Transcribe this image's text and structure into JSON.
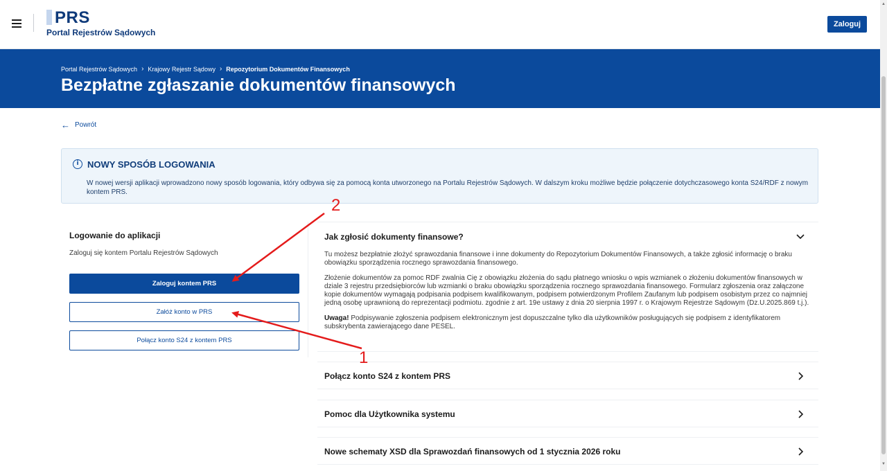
{
  "header": {
    "logo_title": "PRS",
    "logo_subtitle": "Portal Rejestrów Sądowych",
    "login_button": "Zaloguj"
  },
  "banner": {
    "breadcrumb": [
      "Portal Rejestrów Sądowych",
      "Krajowy Rejestr Sądowy",
      "Repozytorium Dokumentów Finansowych"
    ],
    "title": "Bezpłatne zgłaszanie dokumentów finansowych"
  },
  "back_link": "Powrót",
  "info": {
    "icon_glyph": "i",
    "title": "NOWY SPOSÓB LOGOWANIA",
    "text": "W nowej wersji aplikacji wprowadzono nowy sposób logowania, który odbywa się za pomocą konta utworzonego na Portalu Rejestrów Sądowych. W dalszym kroku możliwe będzie połączenie dotychczasowego konta S24/RDF z nowym kontem PRS."
  },
  "login_panel": {
    "title": "Logowanie do aplikacji",
    "description": "Zaloguj się kontem Portalu Rejestrów Sądowych",
    "login_button": "Zaloguj kontem PRS",
    "register_button": "Załóż konto w PRS",
    "connect_button": "Połącz konto S24 z kontem PRS"
  },
  "accordion": {
    "open_item": {
      "title": "Jak zgłosić dokumenty finansowe?",
      "p1": "Tu możesz bezpłatnie złożyć sprawozdania finansowe i inne dokumenty do Repozytorium Dokumentów Finansowych, a także zgłosić informację o braku obowiązku sporządzenia rocznego sprawozdania finansowego.",
      "p2": "Złożenie dokumentów za pomoc RDF zwalnia Cię z obowiązku złożenia do sądu płatnego wniosku o wpis wzmianek o złożeniu dokumentów finansowych w dziale 3 rejestru przedsiębiorców lub wzmianki o braku obowiązku sporządzenia rocznego sprawozdania finansowego. Formularz zgłoszenia oraz załączone kopie dokumentów wymagają podpisania podpisem kwalifikowanym, podpisem potwierdzonym Profilem Zaufanym lub podpisem osobistym przez co najmniej jedną osobę uprawnioną do reprezentacji podmiotu. zgodnie z art. 19e ustawy z dnia 20 sierpnia 1997 r. o Krajowym Rejestrze Sądowym (Dz.U.2025.869 t.j.).",
      "p3_bold": "Uwaga!",
      "p3": " Podpisywanie zgłoszenia podpisem elektronicznym jest dopuszczalne tylko dla użytkowników posługujących się podpisem z identyfikatorem subskrybenta zawierającego dane PESEL."
    },
    "items": [
      {
        "title": "Połącz konto S24 z kontem PRS"
      },
      {
        "title": "Pomoc dla Użytkownika systemu"
      },
      {
        "title": "Nowe schematy XSD dla Sprawozdań finansowych od 1 stycznia 2026 roku"
      }
    ]
  },
  "annotations": {
    "color": "#e41b1b",
    "label_1": "1",
    "label_2": "2"
  },
  "colors": {
    "primary": "#0b4a9c",
    "banner": "#0b4a9c",
    "info_bg": "#eef5fb"
  }
}
